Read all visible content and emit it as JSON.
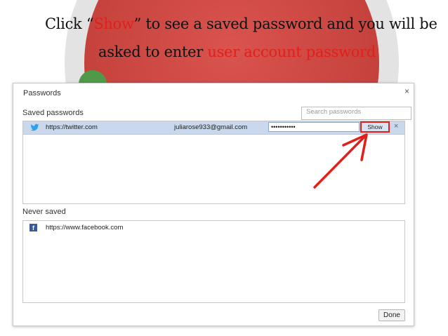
{
  "caption": {
    "line1_pre": "Click “",
    "line1_highlight": "Show",
    "line1_post": "” to see a saved password and you will be",
    "line2_pre": "asked to enter ",
    "line2_highlight": "user account password"
  },
  "dialog": {
    "title": "Passwords",
    "close_icon": "×",
    "saved_label": "Saved passwords",
    "search_placeholder": "Search passwords",
    "saved_rows": [
      {
        "icon": "twitter-icon",
        "site": "https://twitter.com",
        "username": "juliarose933@gmail.com",
        "password_masked": "•••••••••••",
        "show_label": "Show",
        "remove_icon": "×"
      }
    ],
    "never_saved_label": "Never saved",
    "never_saved_rows": [
      {
        "icon": "facebook-icon",
        "icon_glyph": "f",
        "site": "https://www.facebook.com"
      }
    ],
    "done_label": "Done"
  },
  "colors": {
    "highlight_red": "#e0201b",
    "selected_row": "#c9d8ec",
    "facebook_blue": "#3b5998",
    "twitter_blue": "#2aa3ef"
  }
}
